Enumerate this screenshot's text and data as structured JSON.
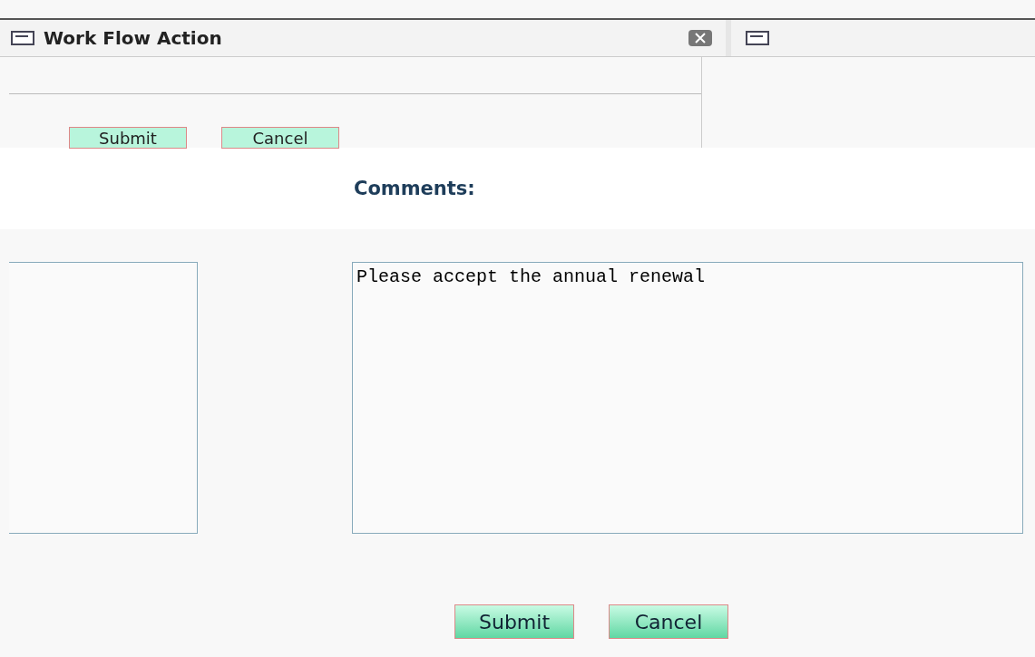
{
  "window": {
    "title": "Work Flow Action"
  },
  "top_buttons": [
    "Submit",
    "Cancel"
  ],
  "comments": {
    "label": "Comments:",
    "value": "Please accept the annual renewal"
  },
  "buttons": [
    "Submit",
    "Cancel"
  ]
}
